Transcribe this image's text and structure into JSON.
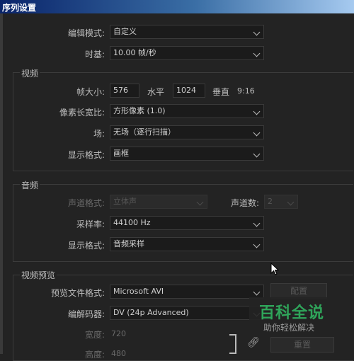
{
  "window": {
    "title": "序列设置"
  },
  "general": {
    "edit_mode": {
      "label": "编辑模式:",
      "value": "自定义"
    },
    "timebase": {
      "label": "时基:",
      "value": "10.00  帧/秒"
    }
  },
  "video": {
    "section_label": "视频",
    "frame_size": {
      "label": "帧大小:",
      "horizontal_value": "576",
      "horizontal_label": "水平",
      "vertical_value": "1024",
      "vertical_label": "垂直",
      "ratio": "9:16"
    },
    "pixel_aspect": {
      "label": "像素长宽比:",
      "value": "方形像素 (1.0)"
    },
    "fields": {
      "label": "场:",
      "value": "无场（逐行扫描）"
    },
    "display_format": {
      "label": "显示格式:",
      "value": "画框"
    }
  },
  "audio": {
    "section_label": "音频",
    "channel_format": {
      "label": "声道格式:",
      "value": "立体声"
    },
    "channel_count": {
      "label": "声道数:",
      "value": "2"
    },
    "sample_rate": {
      "label": "采样率:",
      "value": "44100 Hz"
    },
    "display_format": {
      "label": "显示格式:",
      "value": "音频采样"
    }
  },
  "preview": {
    "section_label": "视频预览",
    "file_format": {
      "label": "预览文件格式:",
      "value": "Microsoft AVI"
    },
    "codec": {
      "label": "编解码器:",
      "value": "DV (24p Advanced)"
    },
    "width": {
      "label": "宽度:",
      "value": "720"
    },
    "height": {
      "label": "高度:",
      "value": "480"
    },
    "configure_button": "配置",
    "reset_button": "重置"
  },
  "watermark": {
    "title": "百科全说",
    "subtitle": "助你轻松解决"
  },
  "icons": {
    "link": "link-icon",
    "chevron": "chevron-down-icon",
    "cursor": "mouse-cursor-icon"
  }
}
